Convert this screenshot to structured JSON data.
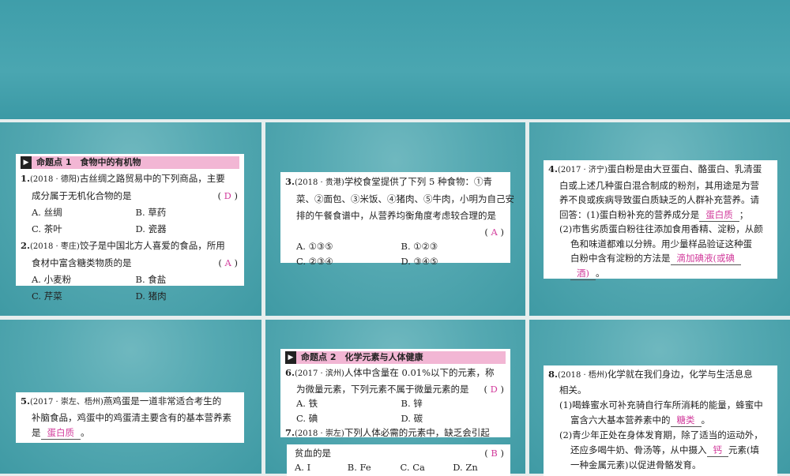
{
  "section1": {
    "title": "命题点 1　食物中的有机物"
  },
  "q1": {
    "num": "1.",
    "src": "(2018 · 德阳)",
    "l1": "古丝绸之路贸易中的下列商品，主要",
    "l2": "成分属于无机化合物的是",
    "answer": "D",
    "A": "A. 丝绸",
    "B": "B. 草药",
    "C": "C. 茶叶",
    "D": "D. 瓷器"
  },
  "q2": {
    "num": "2.",
    "src": "(2018 · 枣庄)",
    "l1": "饺子是中国北方人喜爱的食品，所用",
    "l2": "食材中富含糖类物质的是",
    "answer": "A",
    "A": "A. 小麦粉",
    "B": "B. 食盐",
    "C": "C. 芹菜",
    "D": "D. 猪肉"
  },
  "q3": {
    "num": "3.",
    "src": "(2018 · 贵港)",
    "l1": "学校食堂提供了下列 5 种食物：①青",
    "l2": "菜、②面包、③米饭、④猪肉、⑤牛肉，小明为自己安",
    "l3": "排的午餐食谱中，从营养均衡角度考虑较合理的是",
    "answer": "A",
    "A": "A. ①③⑤",
    "B": "B. ①②③",
    "C": "C. ②③④",
    "D": "D. ③④⑤"
  },
  "q4": {
    "num": "4.",
    "src": "(2017 · 济宁)",
    "l1": "蛋白粉是由大豆蛋白、酪蛋白、乳清蛋",
    "l2": "白或上述几种蛋白混合制成的粉剂，其用途是为营",
    "l3": "养不良或疾病导致蛋白质缺乏的人群补充营养。请",
    "l4": "回答：(1)蛋白粉补充的营养成分是",
    "a1": "蛋白质",
    "l4end": "；",
    "l5": "(2)市售劣质蛋白粉往往添加食用香精、淀粉，从颜",
    "l6": "色和味道都难以分辨。用少量样品验证这种蛋",
    "l7": "白粉中含有淀粉的方法是",
    "a2a": "滴加碘液(或碘",
    "a2b": "酒)",
    "l8end": "。"
  },
  "q5": {
    "num": "5.",
    "src": "(2017 · 崇左、梧州)",
    "l1": "燕鸡蛋是一道非常适合考生的",
    "l2": "补脑食品，鸡蛋中的鸡蛋清主要含有的基本营养素",
    "l3": "是",
    "answer": "蛋白质",
    "end": "。"
  },
  "section2": {
    "title": "命题点 2　化学元素与人体健康"
  },
  "q6": {
    "num": "6.",
    "src": "(2017 · 滨州)",
    "l1": "人体中含量在 0.01%以下的元素，称",
    "l2": "为微量元素，下列元素不属于微量元素的是",
    "answer": "D",
    "A": "A. 铁",
    "B": "B. 锌",
    "C": "C. 碘",
    "D": "D. 碳"
  },
  "q7": {
    "num": "7.",
    "src": "(2018 · 崇左)",
    "l1": "下列人体必需的元素中，缺乏会引起",
    "l2": "贫血的是",
    "answer": "B",
    "A": "A. I",
    "B": "B. Fe",
    "C": "C. Ca",
    "D": "D. Zn"
  },
  "q8": {
    "num": "8.",
    "src": "(2018 · 梧州)",
    "l1": "化学就在我们身边，化学与生活息息",
    "l2": "相关。",
    "l3": "(1)喝蜂蜜水可补充骑自行车所消耗的能量，蜂蜜中",
    "l4": "富含六大基本营养素中的",
    "a1": "糖类",
    "l4end": "。",
    "l5": "(2)青少年正处在身体发育期，除了适当的运动外，",
    "l6": "还应多喝牛奶、骨汤等，从中摄入",
    "a2": "钙",
    "l6end": "元素(填",
    "l7": "一种金属元素)以促进骨骼发育。"
  },
  "paren_open": "(",
  "paren_close": ")"
}
